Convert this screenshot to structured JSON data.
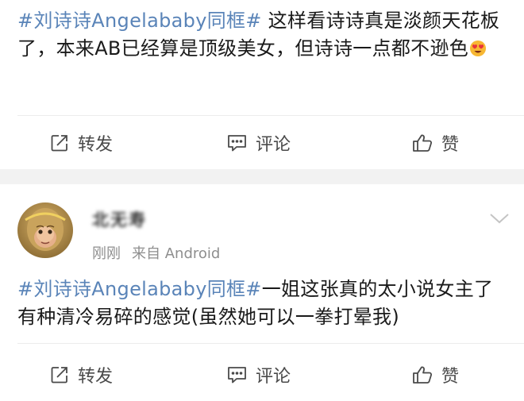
{
  "post1": {
    "topic": "#刘诗诗Angelababy同框#",
    "body": " 这样看诗诗真是淡颜天花板了，本来AB已经算是顶级美女，但诗诗一点都不逊色",
    "emoji": "heart-eyes-emoji"
  },
  "post2": {
    "username": "北无寿",
    "time": "刚刚",
    "source_prefix": "来自",
    "source_app": "Android",
    "topic": "#刘诗诗Angelababy同框#",
    "body": "一姐这张真的太小说女主了 有种清冷易碎的感觉(虽然她可以一拳打晕我)"
  },
  "actions": {
    "repost": "转发",
    "comment": "评论",
    "like": "赞"
  },
  "colors": {
    "topic": "#5a84b8",
    "separator": "#f2f2f2",
    "meta": "#8e8e8e"
  }
}
